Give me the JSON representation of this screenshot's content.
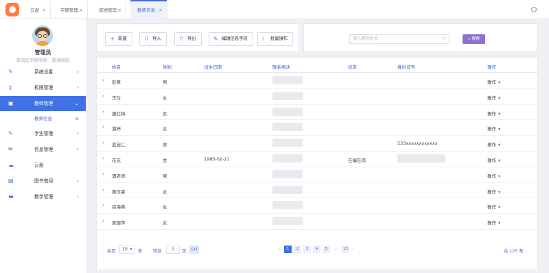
{
  "tabs": [
    {
      "label": "云盘"
    },
    {
      "label": "学期管理"
    },
    {
      "label": "成绩管理"
    },
    {
      "label": "教师信息",
      "active": true
    }
  ],
  "tab_close": "×",
  "user": {
    "name": "管理员",
    "school": "双流区实验学校、棠湖校园"
  },
  "menu": [
    {
      "label": "系统设置",
      "icon": "wrench-icon"
    },
    {
      "label": "权限管理",
      "icon": "key-icon"
    },
    {
      "label": "教师管理",
      "icon": "briefcase-icon",
      "active": true
    },
    {
      "label": "学生管理",
      "icon": "pencil-icon"
    },
    {
      "label": "信息管理",
      "icon": "mail-icon"
    },
    {
      "label": "云盘",
      "icon": "cloud-icon"
    },
    {
      "label": "图书借阅",
      "icon": "book-icon"
    },
    {
      "label": "教学管理",
      "icon": "card-icon"
    }
  ],
  "submenu": {
    "label": "教师信息"
  },
  "toolbar": {
    "new": "新建",
    "import": "导入",
    "export": "导出",
    "edit_fields": "编辑信息字段",
    "batch": "批量操作"
  },
  "search": {
    "placeholder": "输入教师姓名",
    "button": "搜索"
  },
  "table": {
    "headers": [
      "姓名",
      "性别",
      "出生日期",
      "联系电话",
      "状态",
      "身份证号",
      "操作"
    ],
    "rows": [
      {
        "name": "彭爽",
        "gender": "男",
        "birth": "",
        "status": "",
        "id": "",
        "op": "操作"
      },
      {
        "name": "王玲",
        "gender": "女",
        "birth": "",
        "status": "",
        "id": "",
        "op": "操作"
      },
      {
        "name": "唐红梅",
        "gender": "女",
        "birth": "",
        "status": "",
        "id": "",
        "op": "操作"
      },
      {
        "name": "游婷",
        "gender": "女",
        "birth": "",
        "status": "",
        "id": "",
        "op": "操作"
      },
      {
        "name": "蓝启仁",
        "gender": "男",
        "birth": "",
        "status": "",
        "id": "533xxxxxxxxxxxx",
        "op": "操作"
      },
      {
        "name": "花花",
        "gender": "女",
        "birth": "1985-02-21",
        "status": "在编在岗",
        "id": "",
        "op": "操作"
      },
      {
        "name": "谭老师",
        "gender": "男",
        "birth": "",
        "status": "",
        "id": "",
        "op": "操作"
      },
      {
        "name": "黄信睿",
        "gender": "女",
        "birth": "",
        "status": "",
        "id": "",
        "op": "操作"
      },
      {
        "name": "白海燕",
        "gender": "女",
        "birth": "",
        "status": "",
        "id": "",
        "op": "操作"
      },
      {
        "name": "吴丽萍",
        "gender": "女",
        "birth": "",
        "status": "",
        "id": "",
        "op": "操作"
      }
    ]
  },
  "pager": {
    "per_page_label": "每页",
    "per_page_value": "10",
    "per_page_unit": "条",
    "goto_label": "转到",
    "goto_value": "1",
    "goto_unit": "页",
    "go": "GO",
    "pages": [
      "1",
      "2",
      "3",
      "4",
      "5"
    ],
    "ellipsis": "...",
    "last_page": "13",
    "prev": "‹",
    "next": "›",
    "total": "共 125 条"
  },
  "colors": {
    "accent": "#4171e6",
    "search_button": "#8c72cc"
  }
}
